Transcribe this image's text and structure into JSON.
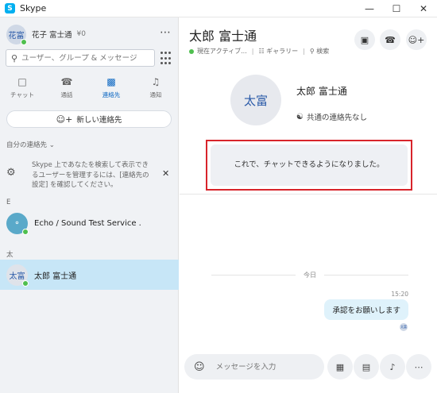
{
  "window": {
    "title": "Skype",
    "app_icon": "S"
  },
  "sidebar": {
    "profile": {
      "initials": "花富",
      "name": "花子 富士通",
      "credit": "¥0"
    },
    "search": {
      "placeholder": "ユーザー、グループ & メッセージ"
    },
    "nav": [
      {
        "label": "チャット",
        "icon": "chat-icon"
      },
      {
        "label": "通話",
        "icon": "phone-icon"
      },
      {
        "label": "連絡先",
        "icon": "contacts-icon",
        "active": true
      },
      {
        "label": "通知",
        "icon": "bell-icon"
      }
    ],
    "new_contact_label": "新しい連絡先",
    "my_contacts_label": "自分の連絡先",
    "hint_text": "Skype 上であなたを検索して表示できるユーザーを管理するには、[連絡先の設定] を確認してください。",
    "groups": [
      {
        "letter": "E",
        "contact": "Echo / Sound Test Service ."
      },
      {
        "letter": "太",
        "contact": "太郎 富士通",
        "initials": "太富",
        "selected": true
      }
    ]
  },
  "chat": {
    "title": "太郎 富士通",
    "status": "現在アクティブ...",
    "gallery": "ギャラリー",
    "search": "検索",
    "card": {
      "initials": "太富",
      "name": "太郎 富士通",
      "shared": "共通の連絡先なし"
    },
    "notice": "これで、チャットできるようになりました。",
    "date_label": "今日",
    "message": {
      "time": "15:20",
      "text": "承認をお願いします",
      "read_initials": "太富"
    },
    "composer_placeholder": "メッセージを入力"
  },
  "colors": {
    "accent": "#0a66c2",
    "presence": "#4fbf4f",
    "selected": "#c7e6f7",
    "highlight": "#d8242b"
  }
}
